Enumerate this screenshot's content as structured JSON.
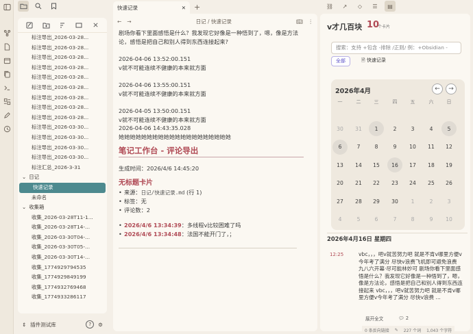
{
  "ribbon_icons": [
    "sidebar-toggle-icon",
    "graph-icon",
    "file-icon",
    "calendar-icon",
    "copy-icon",
    "terminal-icon",
    "blocks-icon",
    "edit-icon",
    "clock-icon"
  ],
  "left": {
    "files": [
      "标注导出_2026-03-28...",
      "标注导出_2026-03-28...",
      "标注导出_2026-03-28...",
      "标注导出_2026-03-28...",
      "标注导出_2026-03-28...",
      "标注导出_2026-03-28...",
      "标注导出_2026-03-28...",
      "标注导出_2026-03-28...",
      "标注导出_2026-03-28...",
      "标注导出_2026-03-30...",
      "标注导出_2026-03-30...",
      "标注导出_2026-03-30...",
      "标注导出_2026-03-30...",
      "标注汇总_2026-3-31"
    ],
    "folder_diary": "日记",
    "diary_selected": "快速记录",
    "diary_untitled": "未命名",
    "folder_inbox": "收集箱",
    "inbox_files": [
      "收集_2026-03-28T11-1...",
      "收集_2026-03-28T14-...",
      "收集_2026-03-30T04-...",
      "收集_2026-03-30T05-...",
      "收集_2026-03-30T14-...",
      "收集_1774929794535",
      "收集_1774929849199",
      "收集_1774932769468",
      "收集_1774933286117"
    ],
    "vault_name": "插件测试库"
  },
  "center": {
    "tab_title": "快速记录",
    "breadcrumb": "日记 / 快速记录",
    "para_top": "剧场你看下里面感悟是什么？我发现它好像是一种悟到了，嗯，像是方法论，感悟是把自己和别人得到东西连接起来?",
    "entries": [
      {
        "ts": "2026-04-06 13:52:00.151",
        "text": "v就不可能连续不健康的本来就方面"
      },
      {
        "ts": "2026-04-06 13:55:00.151",
        "text": "v就不可能连续不健康的本来就方面"
      }
    ],
    "entry3_ts": "2026-04-05 13:50:00.151",
    "entry3_text": "v就不可能连续不健康的本来就方面",
    "entry3_ts2": "2026-04-06 14:43:35.028",
    "entry3_extra": "她她她她她她她她她她她她她她她她她她她她",
    "h1": "笔记工作台 - 评论导出",
    "gen_time": "生成时间：2026/4/6 14:45:20",
    "h2": "无标题卡片",
    "source_label": "来源：",
    "source_path": "日记/快速记录.md",
    "source_line": "(行 1)",
    "tags": "标签：无",
    "comment_count": "评论数：2",
    "comments": [
      {
        "time": "2026/4/6 13:34:39",
        "text": "：多线程v比较困难了吗"
      },
      {
        "time": "2026/4/6 13:34:48",
        "text": "：法国不能开门了，；"
      }
    ]
  },
  "right": {
    "title": "v才几百块",
    "count": "10",
    "count_unit": "个卡片",
    "search_placeholder": "搜索：支持 +包含 -排除 /正则/  例：+Obsidian -",
    "chip_all": "全部",
    "chip_quick": "快速记录",
    "month": "2026年4月",
    "weekdays": [
      "一",
      "二",
      "三",
      "四",
      "五",
      "六",
      "日"
    ],
    "days": [
      [
        "30",
        "31",
        "1",
        "2",
        "3",
        "4",
        "5"
      ],
      [
        "6",
        "7",
        "8",
        "9",
        "10",
        "11",
        "12"
      ],
      [
        "13",
        "14",
        "15",
        "16",
        "17",
        "18",
        "19"
      ],
      [
        "20",
        "21",
        "22",
        "23",
        "24",
        "25",
        "26"
      ],
      [
        "27",
        "28",
        "29",
        "30",
        "1",
        "2",
        "3"
      ],
      [
        "4",
        "5",
        "6",
        "7",
        "8",
        "9",
        "10"
      ]
    ],
    "day_header": "2026年4月16日 星期四",
    "entry_time": "12:25",
    "entry_text": "vbc，，，吧v就苦努力吧 就是不肯v哪里方便v今年考了满分 尽快v浪费飞机即可避免浪费 九八六开幕·尽可能林妙可 剧场你看下里面感悟是什么？我发现它好像是一种悟到了，嗯，像是方法论，感悟是把自己和别人得到东西连接起来\nvbc，，，吧v就苦努力吧 就是不肯v哪里方便v今年考了满分 尽快v浪费 ...",
    "expand_label": "展开全文",
    "comment_count": "2",
    "status_backlinks": "0 条反向链接",
    "status_words": "227 个词",
    "status_chars": "1,043 个字符"
  }
}
